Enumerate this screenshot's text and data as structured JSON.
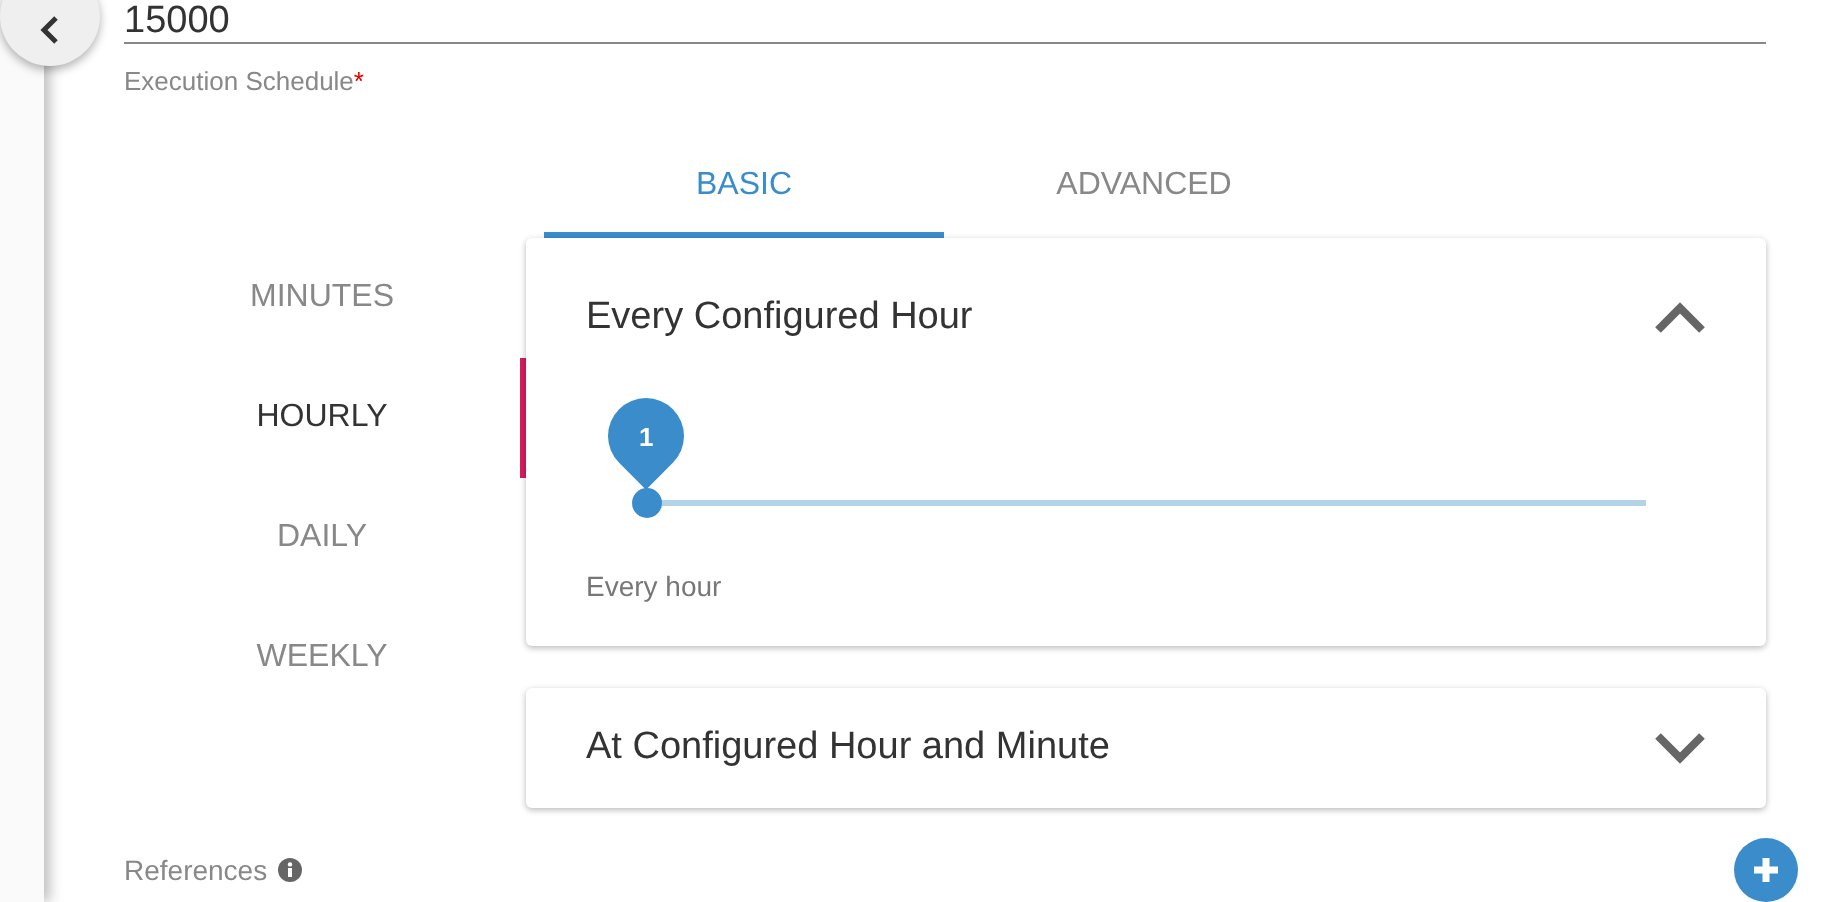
{
  "interval_field": {
    "value": "15000"
  },
  "schedule_label": {
    "text": "Execution Schedule",
    "required_mark": "*"
  },
  "tabs": [
    {
      "label": "BASIC",
      "selected": true
    },
    {
      "label": "ADVANCED",
      "selected": false
    }
  ],
  "frequencies": [
    {
      "label": "MINUTES",
      "selected": false
    },
    {
      "label": "HOURLY",
      "selected": true
    },
    {
      "label": "DAILY",
      "selected": false
    },
    {
      "label": "WEEKLY",
      "selected": false
    }
  ],
  "panels": [
    {
      "title": "Every Configured Hour",
      "expanded": true,
      "slider": {
        "value_label": "1",
        "level": 0
      },
      "caption": "Every hour"
    },
    {
      "title": "At Configured Hour and Minute",
      "expanded": false
    }
  ],
  "references": {
    "label": "References"
  }
}
